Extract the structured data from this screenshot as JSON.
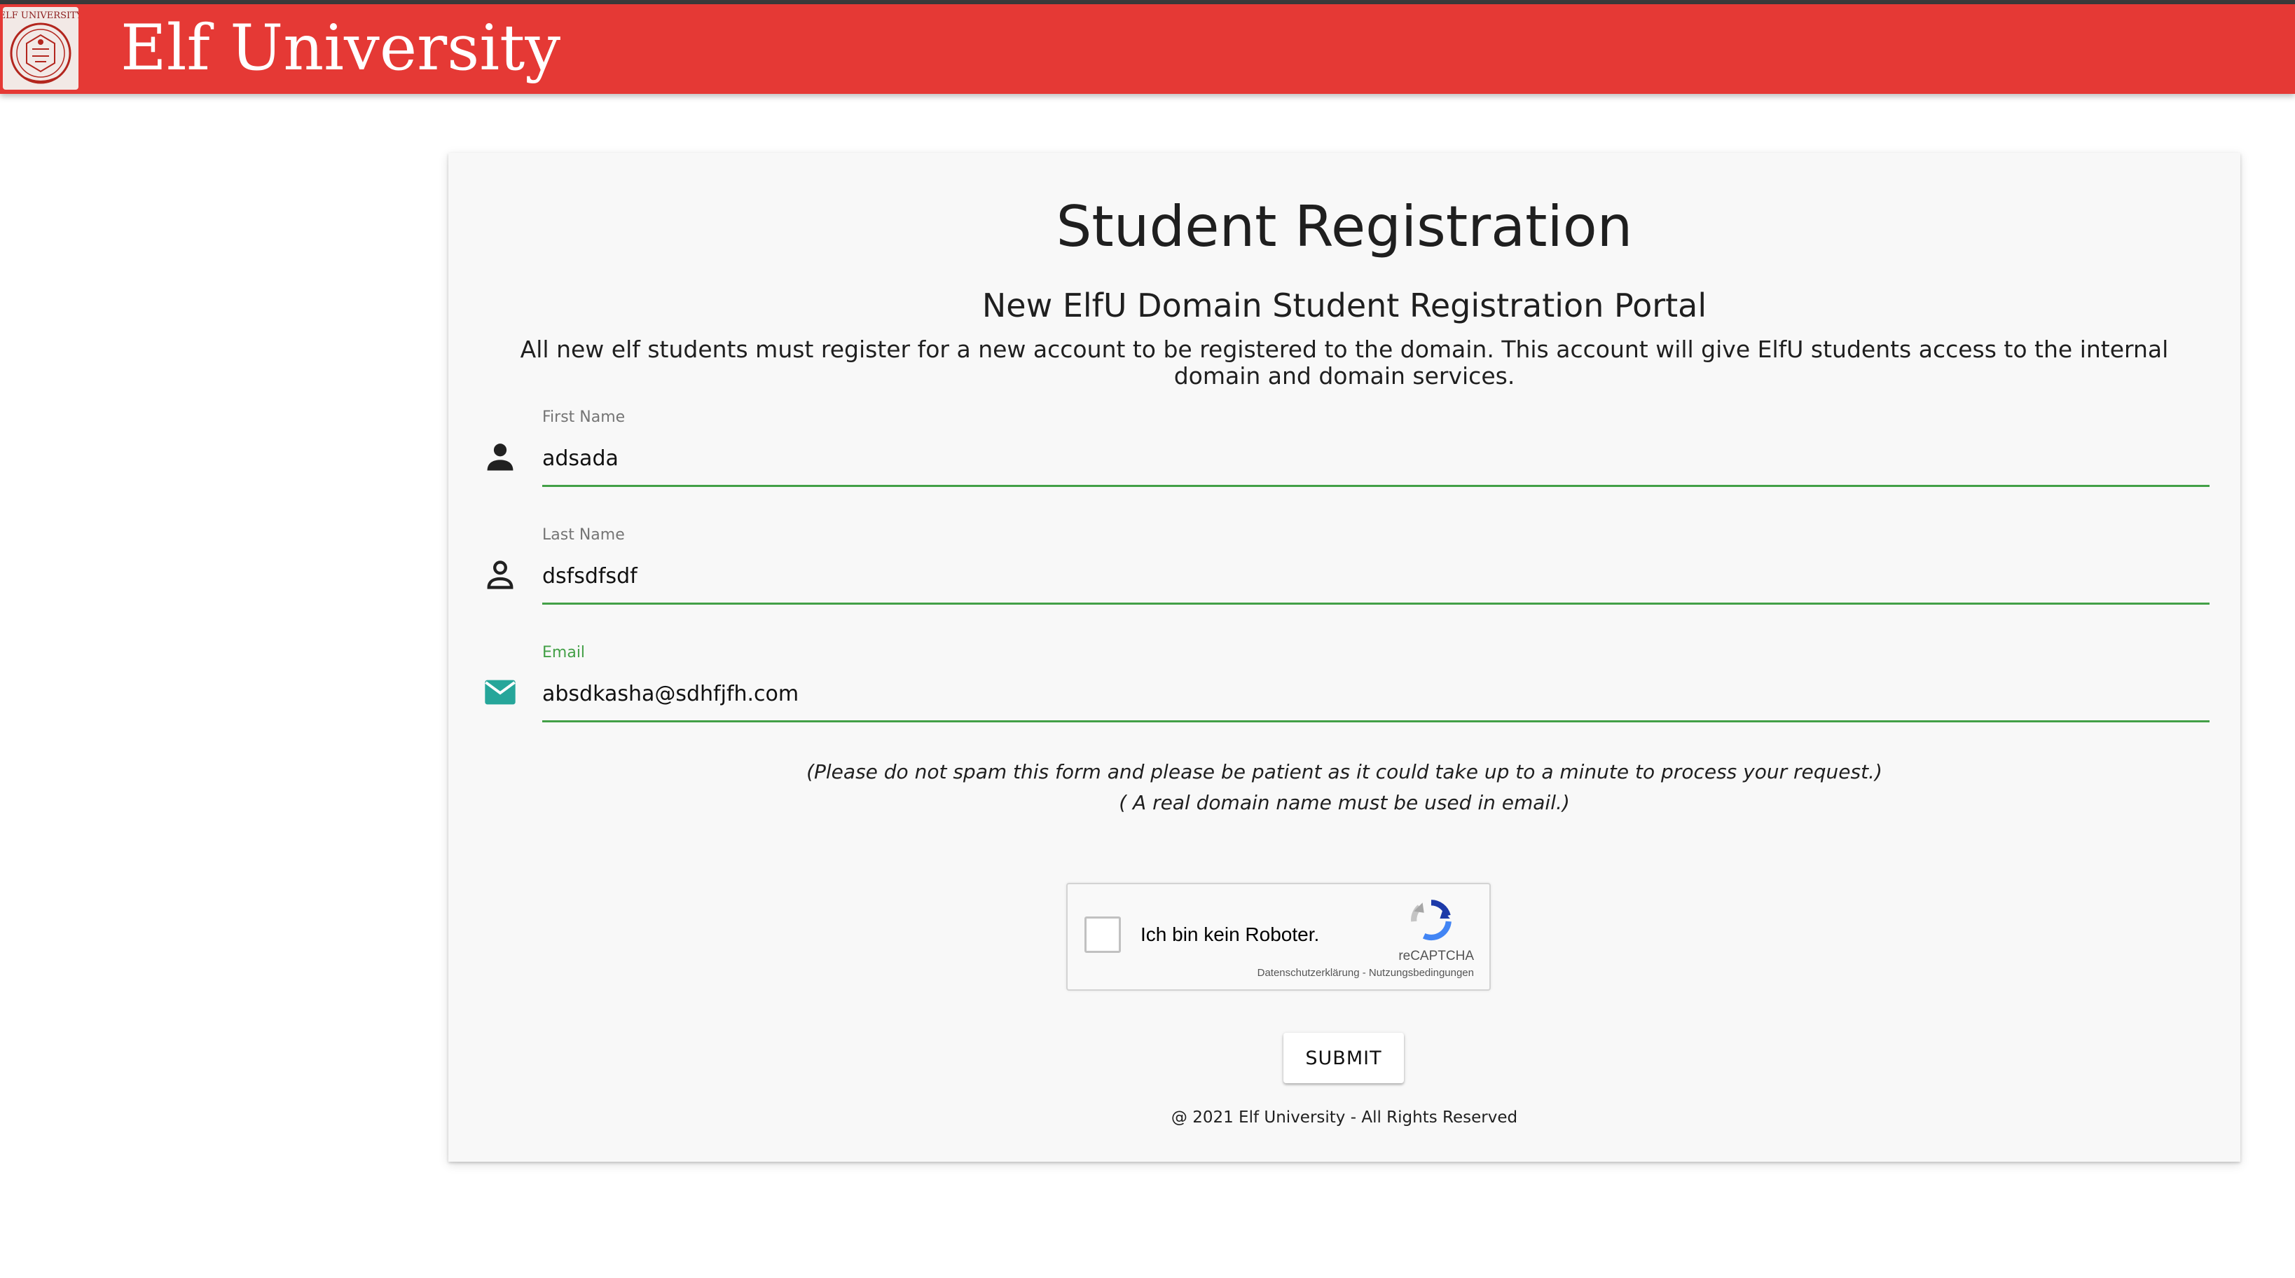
{
  "header": {
    "title": "Elf University",
    "logo_icon": "elf-university-crest",
    "logo_text": "ELF UNIVERSITY",
    "background_color": "#e53935"
  },
  "form": {
    "title": "Student Registration",
    "subtitle": "New ElfU Domain Student Registration Portal",
    "description": "All new elf students must register for a new account to be registered to the domain. This account will give ElfU students access to the internal domain and domain services.",
    "fields": {
      "first_name": {
        "label": "First Name",
        "value": "adsada",
        "icon": "person-filled-icon"
      },
      "last_name": {
        "label": "Last Name",
        "value": "dsfsdfsdf",
        "icon": "person-outline-icon"
      },
      "email": {
        "label": "Email",
        "value": "absdkasha@sdhfjfh.com",
        "icon": "mail-icon",
        "focused": true
      }
    },
    "notes": [
      "(Please do not spam this form and please be patient as it could take up to a minute to process your request.)",
      "( A real domain name must be used in email.)"
    ],
    "recaptcha": {
      "label": "Ich bin kein Roboter.",
      "brand": "reCAPTCHA",
      "links": "Datenschutzerklärung - Nutzungsbedingungen",
      "checked": false
    },
    "submit_label": "SUBMIT",
    "footer": "@ 2021 Elf University - All Rights Reserved"
  },
  "colors": {
    "accent_green": "#43a047",
    "email_icon_teal": "#26a69a",
    "header_red": "#e53935"
  }
}
